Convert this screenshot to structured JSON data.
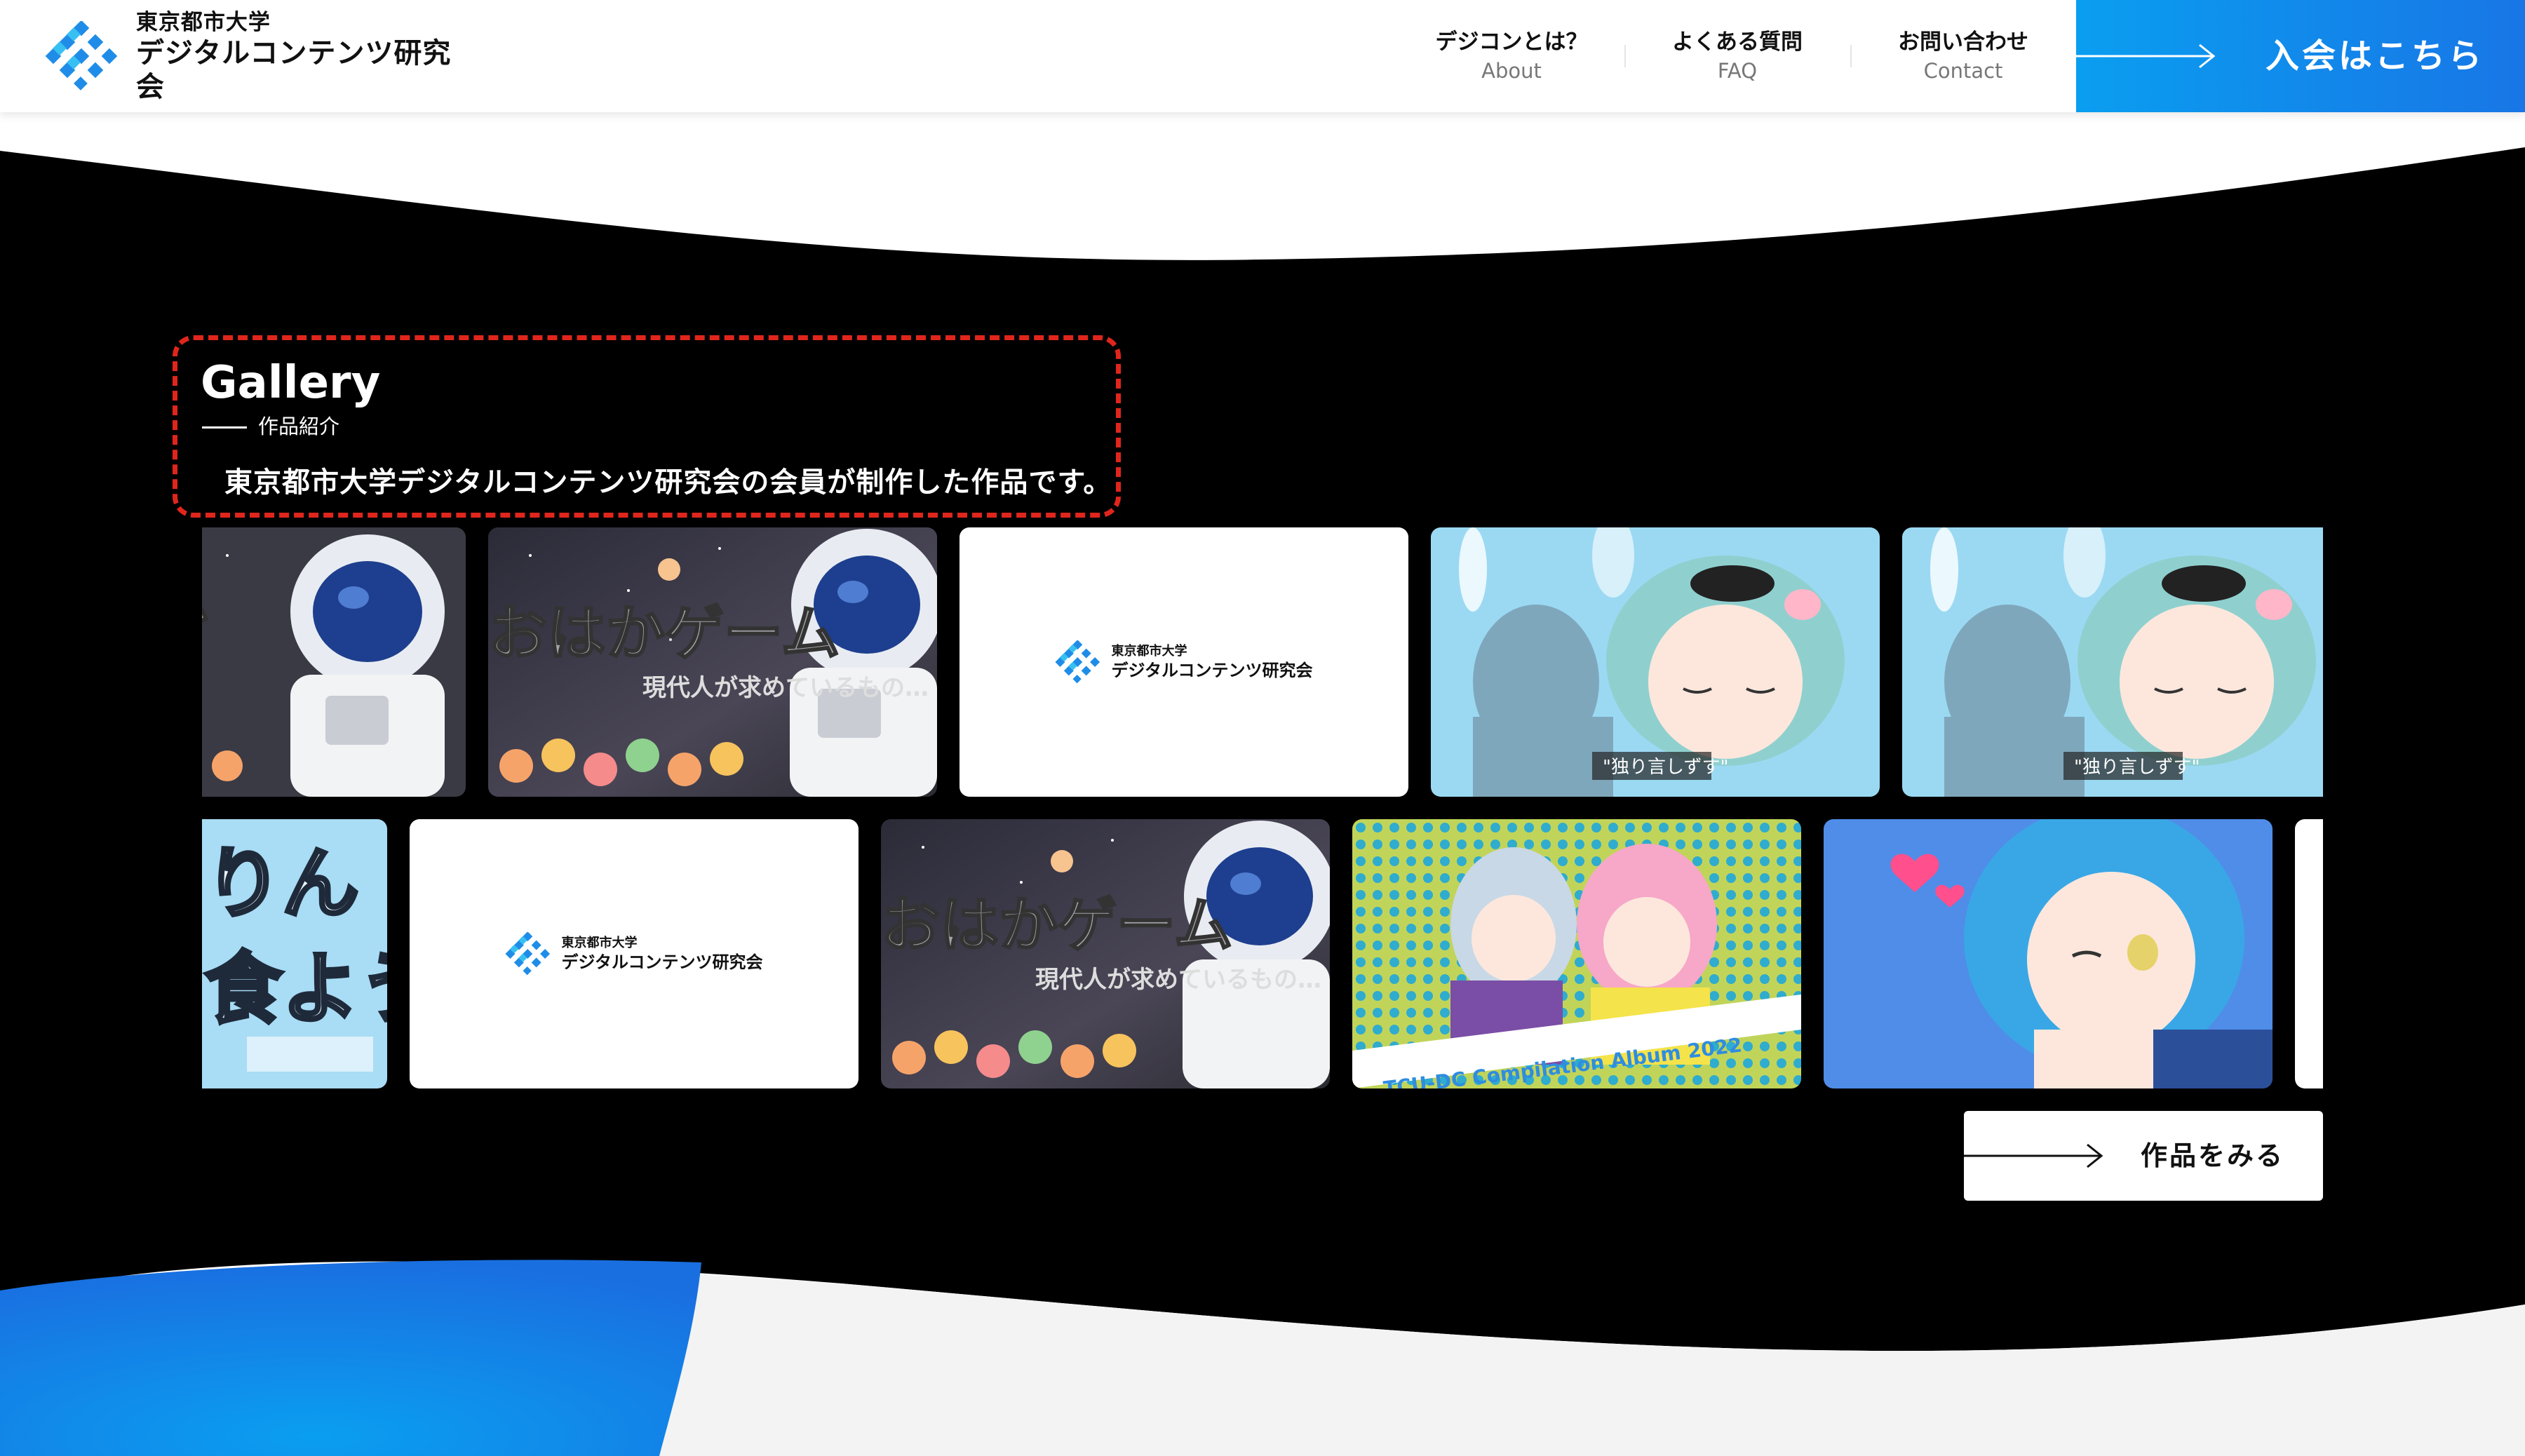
{
  "header": {
    "logo": {
      "line1": "東京都市大学",
      "line2": "デジタルコンテンツ研究会"
    },
    "nav": [
      {
        "jp": "デジコンとは？",
        "en": "About"
      },
      {
        "jp": "よくある質問",
        "en": "FAQ"
      },
      {
        "jp": "お問い合わせ",
        "en": "Contact"
      }
    ],
    "join_label": "入会はこちら"
  },
  "gallery": {
    "title": "Gallery",
    "subtitle": "作品紹介",
    "description": "東京都市大学デジタルコンテンツ研究会の会員が制作した作品です。",
    "tile_logo": {
      "line1": "東京都市大学",
      "line2": "デジタルコンテンツ研究会"
    },
    "row1": [
      {
        "kind": "game-thumbnail",
        "partial": "left"
      },
      {
        "kind": "game-thumbnail"
      },
      {
        "kind": "club-logo"
      },
      {
        "kind": "anime-girl-illustration"
      },
      {
        "kind": "anime-girl-illustration",
        "partial": "right"
      }
    ],
    "row2": [
      {
        "kind": "title-card-illustration",
        "partial": "left"
      },
      {
        "kind": "club-logo"
      },
      {
        "kind": "game-thumbnail"
      },
      {
        "kind": "album-cover"
      },
      {
        "kind": "blue-hair-girl-illustration"
      },
      {
        "kind": "club-logo",
        "partial": "right"
      }
    ],
    "works_button_label": "作品をみる"
  },
  "colors": {
    "brand_blue": "#1876e6",
    "brand_cyan": "#0a9ef0",
    "section_bg": "#000000",
    "highlight_dashed": "#e0261c"
  }
}
